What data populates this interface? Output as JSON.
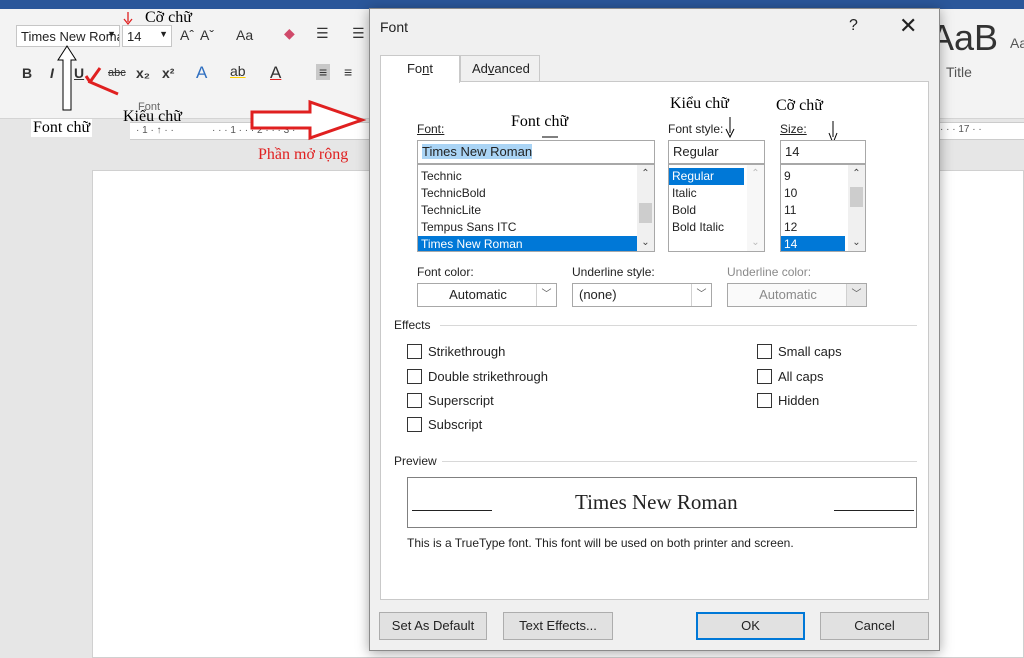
{
  "ribbon": {
    "font_name": "Times New Roman",
    "font_size": "14",
    "bold": "B",
    "italic": "I",
    "underline": "U",
    "strike": "abc",
    "subscript": "x₂",
    "superscript": "x²",
    "change_case": "Aa",
    "group_label": "Font",
    "style_sample": "AaB",
    "style_sample2": "Aa",
    "style_title": "Title"
  },
  "ruler": {
    "left_marks": "· 1 · ↑ · ·",
    "mid_marks": "· · · 1 · · · 2 · · · 3 ·",
    "right_marks": "· · · 17 · ·"
  },
  "annotations": {
    "font_chu_left": "Font chữ",
    "co_chu_top": "Cỡ chữ",
    "kieu_chu_left": "Kiểu chữ",
    "phan_mo_rong": "Phần mở rộng",
    "font_chu_dialog": "Font chữ",
    "kieu_chu_dialog": "Kiểu chữ",
    "co_chu_dialog": "Cỡ chữ"
  },
  "dialog": {
    "title": "Font",
    "help": "?",
    "close": "✕",
    "tabs": [
      {
        "label_pre": "Fo",
        "label_key": "n",
        "label_post": "t"
      },
      {
        "label_pre": "Ad",
        "label_key": "v",
        "label_post": "anced"
      }
    ],
    "font_label": "Font:",
    "font_value": "Times New Roman",
    "font_list": [
      "Technic",
      "TechnicBold",
      "TechnicLite",
      "Tempus Sans ITC",
      "Times New Roman"
    ],
    "style_label": "Font style:",
    "style_value": "Regular",
    "style_list": [
      "Regular",
      "Italic",
      "Bold",
      "Bold Italic"
    ],
    "size_label": "Size:",
    "size_value": "14",
    "size_list": [
      "9",
      "10",
      "11",
      "12",
      "14"
    ],
    "font_color_label": "Font color:",
    "font_color_value": "Automatic",
    "underline_style_label": "Underline style:",
    "underline_style_value": "(none)",
    "underline_color_label": "Underline color:",
    "underline_color_value": "Automatic",
    "effects_label": "Effects",
    "effects_left": [
      "Strikethrough",
      "Double strikethrough",
      "Superscript",
      "Subscript"
    ],
    "effects_right": [
      "Small caps",
      "All caps",
      "Hidden"
    ],
    "preview_label": "Preview",
    "preview_text": "Times New Roman",
    "note": "This is a TrueType font. This font will be used on both printer and screen.",
    "buttons": {
      "set_default": "Set As Default",
      "text_effects": "Text Effects...",
      "ok": "OK",
      "cancel": "Cancel"
    }
  },
  "colors": {
    "accent": "#0078d7",
    "annotation_red": "#e02020",
    "titlebar": "#2b579a"
  }
}
